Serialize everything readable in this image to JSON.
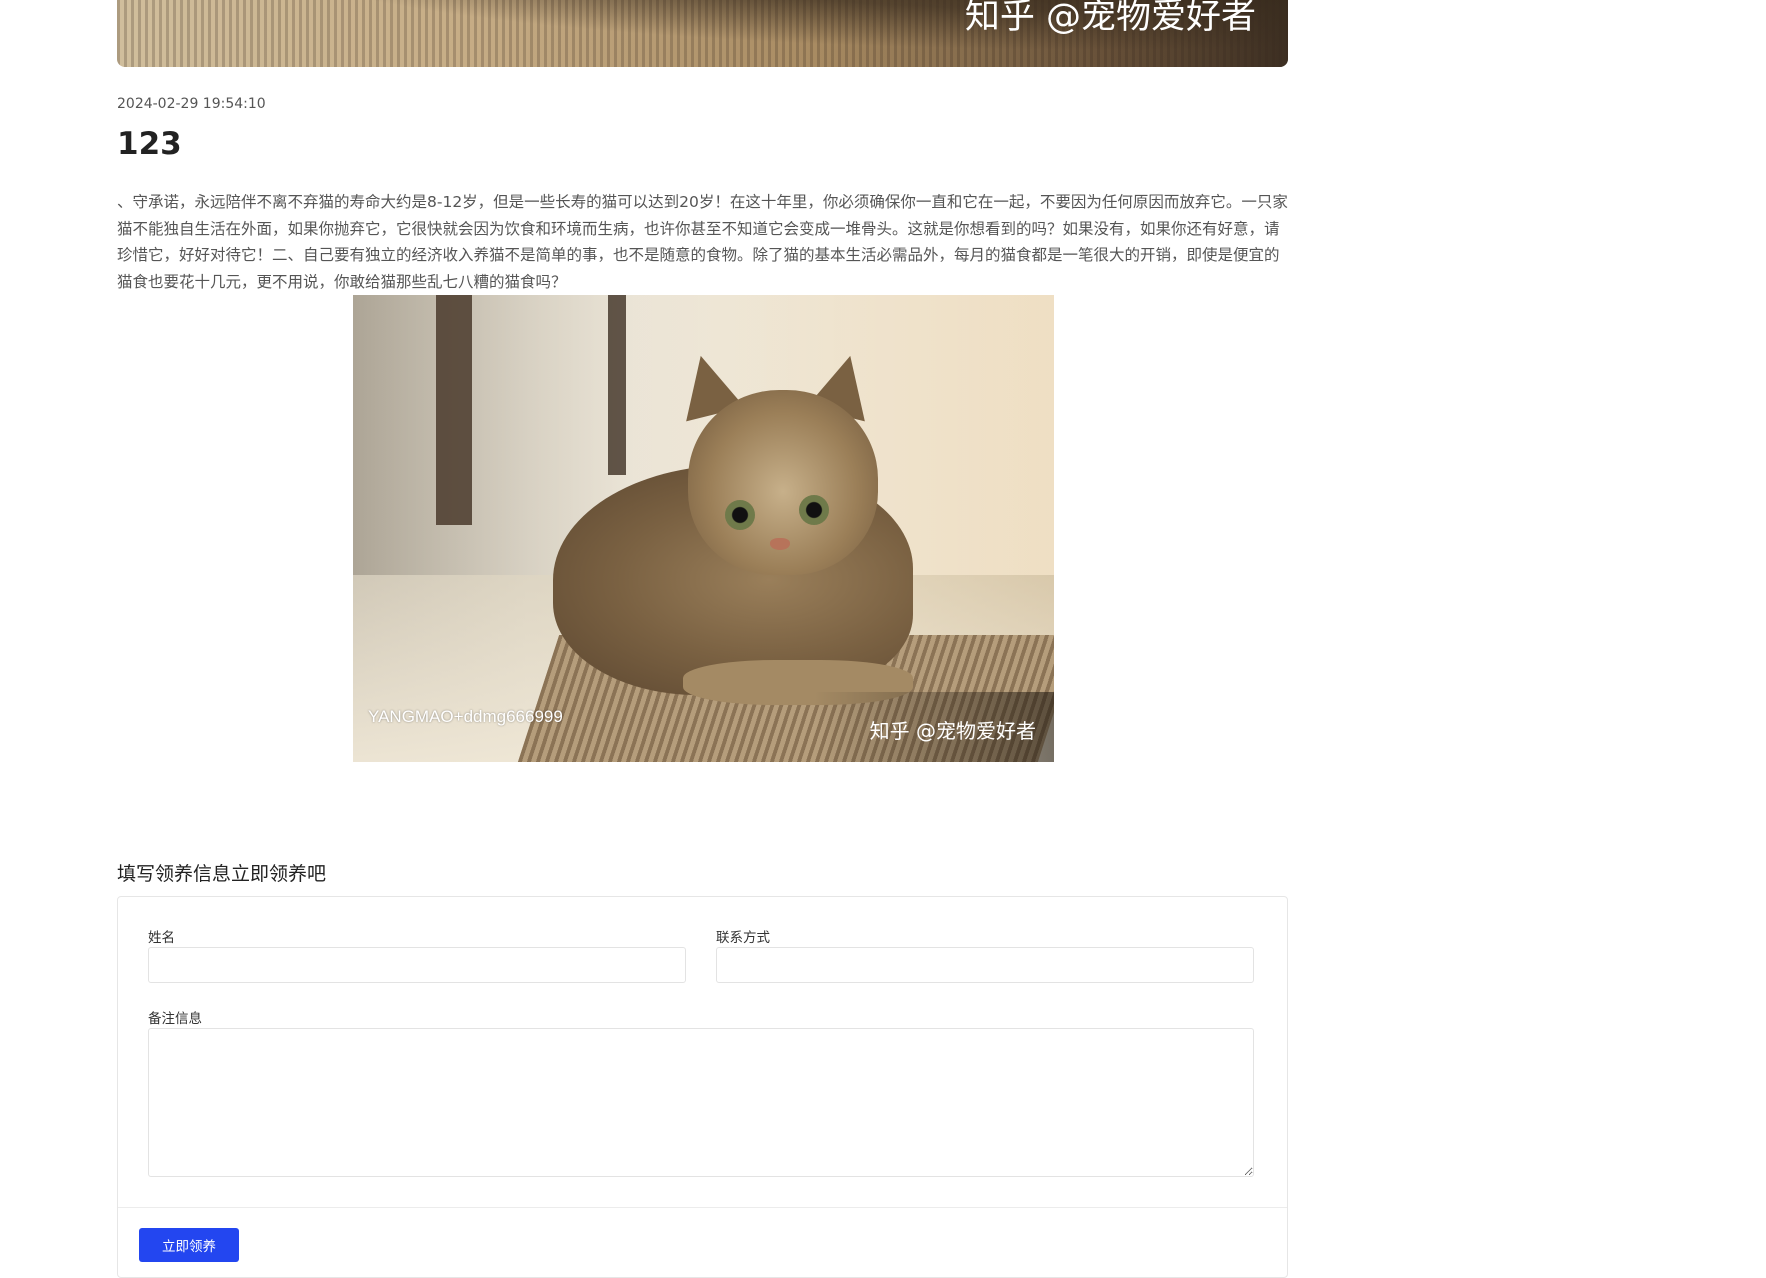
{
  "hero_image": {
    "watermark": "知乎 @宠物爱好者"
  },
  "article": {
    "date": "2024-02-29 19:54:10",
    "title": "123",
    "body": "、守承诺，永远陪伴不离不弃猫的寿命大约是8-12岁，但是一些长寿的猫可以达到20岁！在这十年里，你必须确保你一直和它在一起，不要因为任何原因而放弃它。一只家猫不能独自生活在外面，如果你抛弃它，它很快就会因为饮食和环境而生病，也许你甚至不知道它会变成一堆骨头。这就是你想看到的吗？如果没有，如果你还有好意，请珍惜它，好好对待它！二、自己要有独立的经济收入养猫不是简单的事，也不是随意的食物。除了猫的基本生活必需品外，每月的猫食都是一笔很大的开销，即使是便宜的猫食也要花十几元，更不用说，你敢给猫那些乱七八糟的猫食吗？",
    "image": {
      "watermark_left": "YANGMAO+ddmg666999",
      "watermark_right": "知乎 @宠物爱好者"
    }
  },
  "adoption_form": {
    "heading": "填写领养信息立即领养吧",
    "name_label": "姓名",
    "name_value": "",
    "contact_label": "联系方式",
    "contact_value": "",
    "notes_label": "备注信息",
    "notes_value": "",
    "submit_label": "立即领养"
  },
  "colors": {
    "primary_button": "#2346f0",
    "border": "#e3e3e3"
  }
}
